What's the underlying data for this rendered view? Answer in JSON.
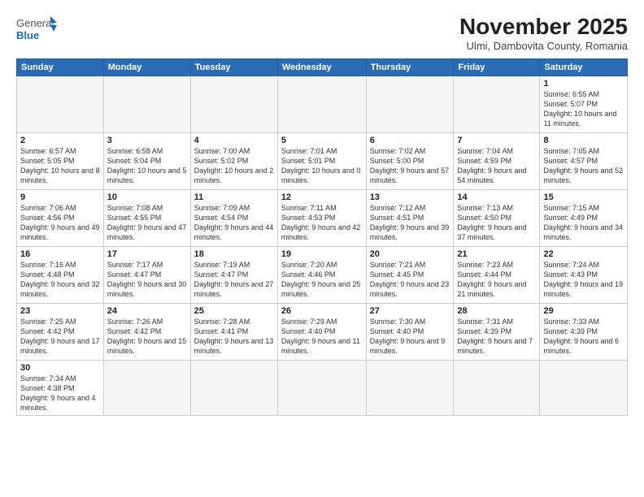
{
  "header": {
    "logo_general": "General",
    "logo_blue": "Blue",
    "month_title": "November 2025",
    "subtitle": "Ulmi, Dambovita County, Romania"
  },
  "days_of_week": [
    "Sunday",
    "Monday",
    "Tuesday",
    "Wednesday",
    "Thursday",
    "Friday",
    "Saturday"
  ],
  "weeks": [
    [
      {
        "day": "",
        "info": ""
      },
      {
        "day": "",
        "info": ""
      },
      {
        "day": "",
        "info": ""
      },
      {
        "day": "",
        "info": ""
      },
      {
        "day": "",
        "info": ""
      },
      {
        "day": "",
        "info": ""
      },
      {
        "day": "1",
        "info": "Sunrise: 6:55 AM\nSunset: 5:07 PM\nDaylight: 10 hours\nand 11 minutes."
      }
    ],
    [
      {
        "day": "2",
        "info": "Sunrise: 6:57 AM\nSunset: 5:05 PM\nDaylight: 10 hours\nand 8 minutes."
      },
      {
        "day": "3",
        "info": "Sunrise: 6:58 AM\nSunset: 5:04 PM\nDaylight: 10 hours\nand 5 minutes."
      },
      {
        "day": "4",
        "info": "Sunrise: 7:00 AM\nSunset: 5:02 PM\nDaylight: 10 hours\nand 2 minutes."
      },
      {
        "day": "5",
        "info": "Sunrise: 7:01 AM\nSunset: 5:01 PM\nDaylight: 10 hours\nand 0 minutes."
      },
      {
        "day": "6",
        "info": "Sunrise: 7:02 AM\nSunset: 5:00 PM\nDaylight: 9 hours\nand 57 minutes."
      },
      {
        "day": "7",
        "info": "Sunrise: 7:04 AM\nSunset: 4:59 PM\nDaylight: 9 hours\nand 54 minutes."
      },
      {
        "day": "8",
        "info": "Sunrise: 7:05 AM\nSunset: 4:57 PM\nDaylight: 9 hours\nand 52 minutes."
      }
    ],
    [
      {
        "day": "9",
        "info": "Sunrise: 7:06 AM\nSunset: 4:56 PM\nDaylight: 9 hours\nand 49 minutes."
      },
      {
        "day": "10",
        "info": "Sunrise: 7:08 AM\nSunset: 4:55 PM\nDaylight: 9 hours\nand 47 minutes."
      },
      {
        "day": "11",
        "info": "Sunrise: 7:09 AM\nSunset: 4:54 PM\nDaylight: 9 hours\nand 44 minutes."
      },
      {
        "day": "12",
        "info": "Sunrise: 7:11 AM\nSunset: 4:53 PM\nDaylight: 9 hours\nand 42 minutes."
      },
      {
        "day": "13",
        "info": "Sunrise: 7:12 AM\nSunset: 4:51 PM\nDaylight: 9 hours\nand 39 minutes."
      },
      {
        "day": "14",
        "info": "Sunrise: 7:13 AM\nSunset: 4:50 PM\nDaylight: 9 hours\nand 37 minutes."
      },
      {
        "day": "15",
        "info": "Sunrise: 7:15 AM\nSunset: 4:49 PM\nDaylight: 9 hours\nand 34 minutes."
      }
    ],
    [
      {
        "day": "16",
        "info": "Sunrise: 7:16 AM\nSunset: 4:48 PM\nDaylight: 9 hours\nand 32 minutes."
      },
      {
        "day": "17",
        "info": "Sunrise: 7:17 AM\nSunset: 4:47 PM\nDaylight: 9 hours\nand 30 minutes."
      },
      {
        "day": "18",
        "info": "Sunrise: 7:19 AM\nSunset: 4:47 PM\nDaylight: 9 hours\nand 27 minutes."
      },
      {
        "day": "19",
        "info": "Sunrise: 7:20 AM\nSunset: 4:46 PM\nDaylight: 9 hours\nand 25 minutes."
      },
      {
        "day": "20",
        "info": "Sunrise: 7:21 AM\nSunset: 4:45 PM\nDaylight: 9 hours\nand 23 minutes."
      },
      {
        "day": "21",
        "info": "Sunrise: 7:23 AM\nSunset: 4:44 PM\nDaylight: 9 hours\nand 21 minutes."
      },
      {
        "day": "22",
        "info": "Sunrise: 7:24 AM\nSunset: 4:43 PM\nDaylight: 9 hours\nand 19 minutes."
      }
    ],
    [
      {
        "day": "23",
        "info": "Sunrise: 7:25 AM\nSunset: 4:42 PM\nDaylight: 9 hours\nand 17 minutes."
      },
      {
        "day": "24",
        "info": "Sunrise: 7:26 AM\nSunset: 4:42 PM\nDaylight: 9 hours\nand 15 minutes."
      },
      {
        "day": "25",
        "info": "Sunrise: 7:28 AM\nSunset: 4:41 PM\nDaylight: 9 hours\nand 13 minutes."
      },
      {
        "day": "26",
        "info": "Sunrise: 7:29 AM\nSunset: 4:40 PM\nDaylight: 9 hours\nand 11 minutes."
      },
      {
        "day": "27",
        "info": "Sunrise: 7:30 AM\nSunset: 4:40 PM\nDaylight: 9 hours\nand 9 minutes."
      },
      {
        "day": "28",
        "info": "Sunrise: 7:31 AM\nSunset: 4:39 PM\nDaylight: 9 hours\nand 7 minutes."
      },
      {
        "day": "29",
        "info": "Sunrise: 7:33 AM\nSunset: 4:39 PM\nDaylight: 9 hours\nand 6 minutes."
      }
    ],
    [
      {
        "day": "30",
        "info": "Sunrise: 7:34 AM\nSunset: 4:38 PM\nDaylight: 9 hours\nand 4 minutes."
      },
      {
        "day": "",
        "info": ""
      },
      {
        "day": "",
        "info": ""
      },
      {
        "day": "",
        "info": ""
      },
      {
        "day": "",
        "info": ""
      },
      {
        "day": "",
        "info": ""
      },
      {
        "day": "",
        "info": ""
      }
    ]
  ]
}
